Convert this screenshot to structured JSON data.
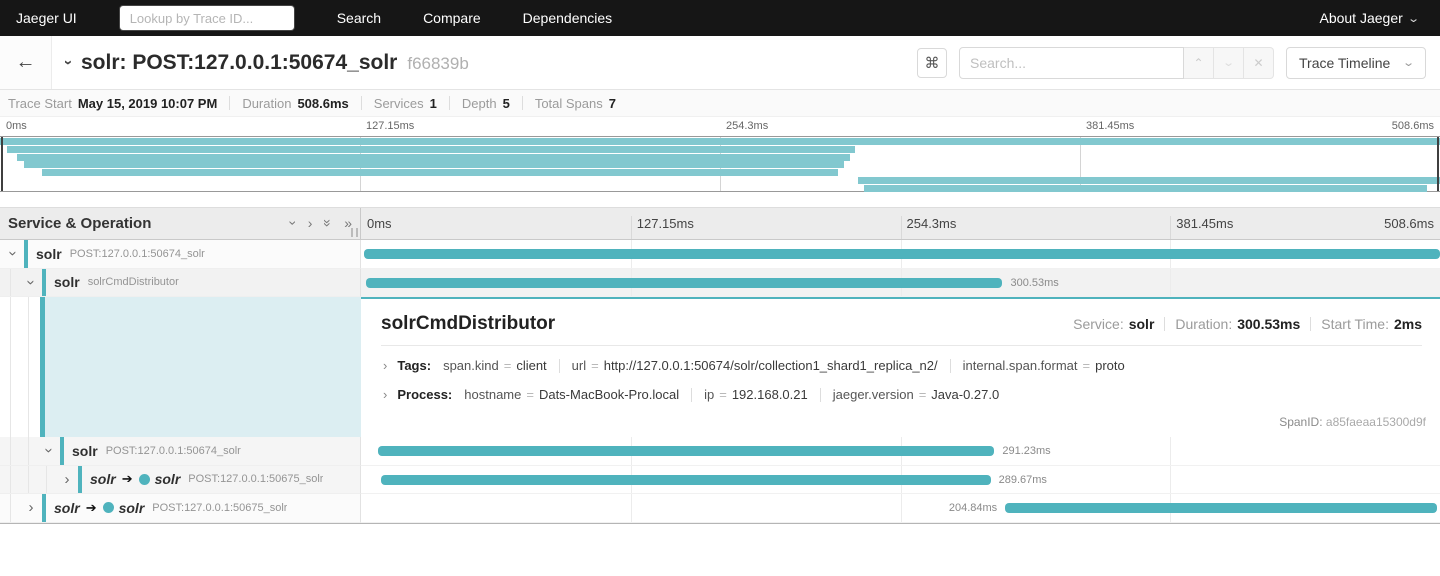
{
  "nav": {
    "brand": "Jaeger UI",
    "lookup_placeholder": "Lookup by Trace ID...",
    "links": [
      "Search",
      "Compare",
      "Dependencies"
    ],
    "about": "About Jaeger"
  },
  "trace_header": {
    "title": "solr: POST:127.0.0.1:50674_solr",
    "trace_id": "f66839b",
    "shortcut_icon": "⌘",
    "search_placeholder": "Search...",
    "view_label": "Trace Timeline"
  },
  "summary": {
    "items": [
      {
        "label": "Trace Start",
        "value": "May 15, 2019 10:07 PM"
      },
      {
        "label": "Duration",
        "value": "508.6ms"
      },
      {
        "label": "Services",
        "value": "1"
      },
      {
        "label": "Depth",
        "value": "5"
      },
      {
        "label": "Total Spans",
        "value": "7"
      }
    ]
  },
  "ticks": [
    "0ms",
    "127.15ms",
    "254.3ms",
    "381.45ms",
    "508.6ms"
  ],
  "minimap": {
    "spans": [
      {
        "start_pct": 0,
        "end_pct": 100
      },
      {
        "start_pct": 0.5,
        "end_pct": 59.4
      },
      {
        "start_pct": 1.2,
        "end_pct": 59.0
      },
      {
        "start_pct": 1.7,
        "end_pct": 58.6
      },
      {
        "start_pct": 2.9,
        "end_pct": 58.2
      },
      {
        "start_pct": 59.6,
        "end_pct": 100
      },
      {
        "start_pct": 60.0,
        "end_pct": 99.1
      }
    ]
  },
  "timeline_header": {
    "title": "Service & Operation",
    "icons": [
      {
        "name": "collapse-one-icon",
        "glyph": "›",
        "rotate": true
      },
      {
        "name": "expand-one-icon",
        "glyph": "›",
        "rotate": false
      },
      {
        "name": "collapse-all-icon",
        "glyph": "»",
        "rotate": true
      },
      {
        "name": "expand-all-icon",
        "glyph": "»",
        "rotate": false
      }
    ]
  },
  "rows": [
    {
      "service": "solr",
      "operation": "POST:127.0.0.1:50674_solr",
      "depth": 0,
      "expanded": true,
      "bar": {
        "start_pct": 0.3,
        "width_pct": 99.7
      }
    },
    {
      "service": "solr",
      "operation": "solrCmdDistributor",
      "depth": 1,
      "expanded": true,
      "selected": true,
      "bar": {
        "start_pct": 0.45,
        "width_pct": 59.0,
        "label": "300.53ms",
        "label_side": "right"
      }
    },
    {
      "service": "solr",
      "operation": "POST:127.0.0.1:50674_solr",
      "depth": 2,
      "expanded": true,
      "shaded": true,
      "bar": {
        "start_pct": 1.6,
        "width_pct": 57.1,
        "label": "291.23ms",
        "label_side": "right"
      }
    },
    {
      "service": "solr",
      "rpc_service": "solr",
      "operation": "POST:127.0.0.1:50675_solr",
      "depth": 3,
      "expanded": false,
      "shaded": true,
      "bar": {
        "start_pct": 1.85,
        "width_pct": 56.5,
        "label": "289.67ms",
        "label_side": "right"
      }
    },
    {
      "service": "solr",
      "rpc_service": "solr",
      "operation": "POST:127.0.0.1:50675_solr",
      "depth": 1,
      "expanded": false,
      "bar": {
        "start_pct": 59.7,
        "width_pct": 40.0,
        "label": "204.84ms",
        "label_side": "left"
      }
    }
  ],
  "detail": {
    "title": "solrCmdDistributor",
    "meta": [
      {
        "label": "Service:",
        "value": "solr"
      },
      {
        "label": "Duration:",
        "value": "300.53ms"
      },
      {
        "label": "Start Time:",
        "value": "2ms"
      }
    ],
    "sections": [
      {
        "label": "Tags:",
        "pairs": [
          {
            "k": "span.kind",
            "v": "client"
          },
          {
            "k": "url",
            "v": "http://127.0.0.1:50674/solr/collection1_shard1_replica_n2/"
          },
          {
            "k": "internal.span.format",
            "v": "proto"
          }
        ]
      },
      {
        "label": "Process:",
        "pairs": [
          {
            "k": "hostname",
            "v": "Dats-MacBook-Pro.local"
          },
          {
            "k": "ip",
            "v": "192.168.0.21"
          },
          {
            "k": "jaeger.version",
            "v": "Java-0.27.0"
          }
        ]
      }
    ],
    "span_id_label": "SpanID:",
    "span_id": "a85faeaa15300d9f"
  },
  "colors": {
    "accent": "#4fb3bd",
    "accent_light": "#82c8cf",
    "fill_light": "#dceef2",
    "nav_bg": "#161616"
  }
}
